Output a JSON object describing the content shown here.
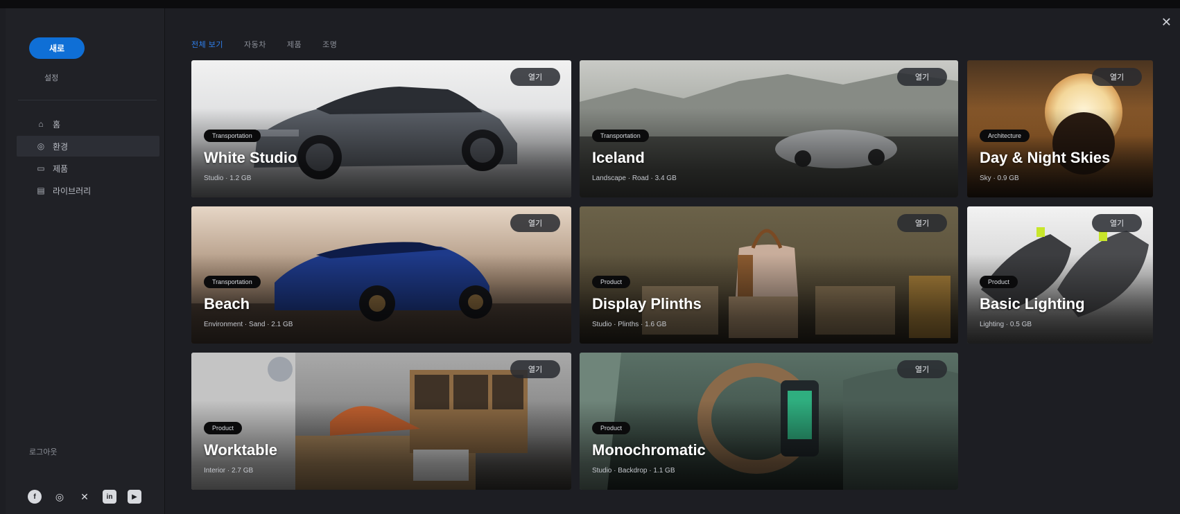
{
  "sidebar": {
    "new_button": "새로",
    "sub_label": "설정",
    "items": [
      {
        "icon": "home-icon",
        "glyph": "⌂",
        "label": "홈"
      },
      {
        "icon": "environment-icon",
        "glyph": "◎",
        "label": "환경"
      },
      {
        "icon": "folder-icon",
        "glyph": "▭",
        "label": "제품"
      },
      {
        "icon": "library-icon",
        "glyph": "▤",
        "label": "라이브러리"
      }
    ],
    "footer_text": "로그아웃",
    "social": [
      {
        "icon": "facebook-icon",
        "glyph": "f"
      },
      {
        "icon": "instagram-icon",
        "glyph": "◎"
      },
      {
        "icon": "x-icon",
        "glyph": "✕"
      },
      {
        "icon": "linkedin-icon",
        "glyph": "in"
      },
      {
        "icon": "youtube-icon",
        "glyph": "▶"
      }
    ]
  },
  "tabs": [
    "전체 보기",
    "자동차",
    "제품",
    "조명"
  ],
  "active_tab": 0,
  "cards": [
    {
      "title": "White Studio",
      "tag": "Transportation",
      "meta": "Studio · 1.2 GB",
      "pill": "열기"
    },
    {
      "title": "Iceland",
      "tag": "Transportation",
      "meta": "Landscape · Road · 3.4 GB",
      "pill": "열기"
    },
    {
      "title": "Day & Night Skies",
      "tag": "Architecture",
      "meta": "Sky · 0.9 GB",
      "pill": "열기"
    },
    {
      "title": "Beach",
      "tag": "Transportation",
      "meta": "Environment · Sand · 2.1 GB",
      "pill": "열기"
    },
    {
      "title": "Display Plinths",
      "tag": "Product",
      "meta": "Studio · Plinths · 1.6 GB",
      "pill": "열기"
    },
    {
      "title": "Basic Lighting",
      "tag": "Product",
      "meta": "Lighting · 0.5 GB",
      "pill": "열기"
    },
    {
      "title": "Worktable",
      "tag": "Product",
      "meta": "Interior · 2.7 GB",
      "pill": "열기"
    },
    {
      "title": "Monochromatic",
      "tag": "Product",
      "meta": "Studio · Backdrop · 1.1 GB",
      "pill": "열기"
    }
  ]
}
